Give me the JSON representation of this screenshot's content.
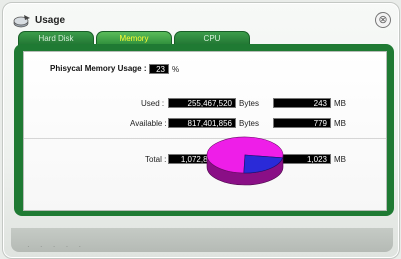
{
  "window": {
    "title": "Usage",
    "close_glyph": "⊗",
    "app_icon": "usage-icon"
  },
  "tabs": [
    {
      "label": "Hard Disk",
      "active": false
    },
    {
      "label": "Memory",
      "active": true
    },
    {
      "label": "CPU",
      "active": false
    }
  ],
  "memory": {
    "usage_label": "Phisycal Memory Usage :",
    "usage_value": "23",
    "usage_unit": "%",
    "used_label": "Used :",
    "used_bytes": "255,467,520",
    "used_mb": "243",
    "available_label": "Available :",
    "available_bytes": "817,401,856",
    "available_mb": "779",
    "total_label": "Total :",
    "total_bytes": "1,072,869,376",
    "total_mb": "1,023",
    "bytes_unit": "Bytes",
    "mb_unit": "MB"
  },
  "chart_data": {
    "type": "pie",
    "values": [
      23,
      77
    ],
    "colors": [
      "#2a2ad8",
      "#ee1ee8"
    ]
  },
  "colors": {
    "accent": "#1f7a33",
    "tab_active_text": "#ffff33"
  }
}
